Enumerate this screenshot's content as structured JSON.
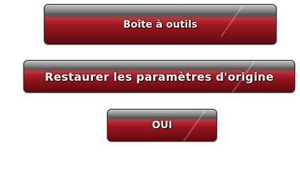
{
  "buttons": {
    "toolbox": {
      "label": "Boîte à outils"
    },
    "restore_defaults": {
      "label": "Restaurer les paramètres d'origine"
    },
    "yes": {
      "label": "OUI"
    }
  },
  "colors": {
    "button_red": "#9a1620",
    "button_dark_top": "#3c3c3c",
    "label_text": "#ffffff",
    "background": "#ffffff"
  }
}
